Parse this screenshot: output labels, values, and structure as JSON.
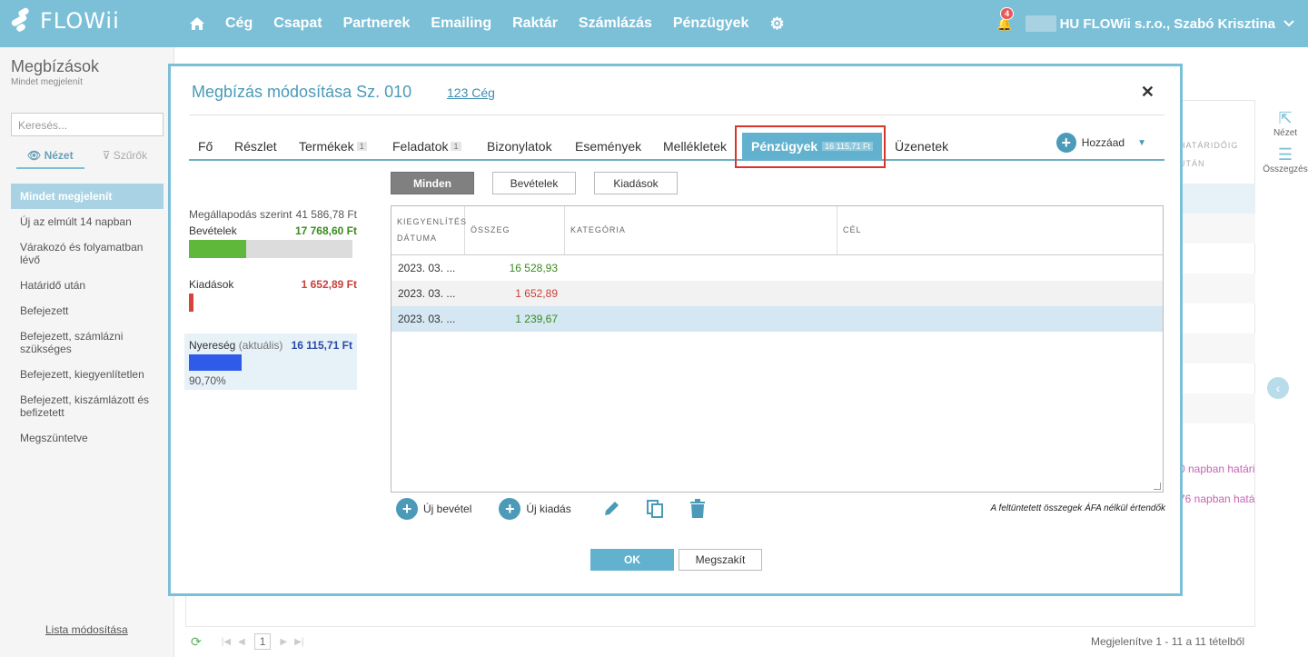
{
  "app": {
    "logo": "FLOWii"
  },
  "nav": {
    "items": [
      "Cég",
      "Csapat",
      "Partnerek",
      "Emailing",
      "Raktár",
      "Számlázás",
      "Pénzügyek"
    ]
  },
  "user": {
    "notifications": "4",
    "name": "HU FLOWii s.r.o., Szabó Krisztina"
  },
  "sidebar": {
    "title": "Megbízások",
    "subtitle": "Mindet megjelenít",
    "search_placeholder": "Keresés...",
    "tab_view": "Nézet",
    "tab_filters": "Szűrők",
    "items": [
      "Mindet megjelenít",
      "Új az elmúlt 14 napban",
      "Várakozó és folyamatban lévő",
      "Határidő után",
      "Befejezett",
      "Befejezett, számlázni szükséges",
      "Befejezett, kiegyenlítetlen",
      "Befejezett, kiszámlázott és befizetett",
      "Megszüntetve"
    ],
    "footer": "Lista módosítása"
  },
  "background": {
    "col_header_1": "HATÁRIDŐIG",
    "col_header_2": "UTÁN",
    "row_text_1": "0 napban határi",
    "row_text_2": "76 napban hatá",
    "rail_view": "Nézet",
    "rail_summary": "Összegzés",
    "pager_current": "1",
    "pager_info": "Megjelenítve 1 - 11 a 11 tételből"
  },
  "modal": {
    "title": "Megbízás módosítása Sz. 010",
    "company_link": "123 Cég",
    "tabs": [
      {
        "label": "Fő",
        "count": ""
      },
      {
        "label": "Részlet",
        "count": ""
      },
      {
        "label": "Termékek",
        "count": "1"
      },
      {
        "label": "Feladatok",
        "count": "1"
      },
      {
        "label": "Bizonylatok",
        "count": ""
      },
      {
        "label": "Események",
        "count": ""
      },
      {
        "label": "Mellékletek",
        "count": ""
      },
      {
        "label": "Pénzügyek",
        "count": "16 115,71 Ft"
      },
      {
        "label": "Üzenetek",
        "count": ""
      }
    ],
    "add_label": "Hozzáad",
    "filters": {
      "all": "Minden",
      "income": "Bevételek",
      "expense": "Kiadások"
    },
    "summary": {
      "agreement_label": "Megállapodás szerint",
      "agreement_value": "41 586,78 Ft",
      "income_label": "Bevételek",
      "income_value": "17 768,60 Ft",
      "income_fill": 0.35,
      "expense_label": "Kiadások",
      "expense_value": "1 652,89 Ft",
      "profit_label": "Nyereség",
      "profit_paren": "(aktuális)",
      "profit_value": "16 115,71 Ft",
      "profit_pct": "90,70%"
    },
    "table": {
      "headers": {
        "date_1": "KIEGYENLÍTÉS",
        "date_2": "DÁTUMA",
        "amount": "ÖSSZEG",
        "category": "KATEGÓRIA",
        "goal": "CÉL"
      },
      "rows": [
        {
          "date": "2023. 03. ...",
          "amount": "16 528,93",
          "color": "#3a8a1e"
        },
        {
          "date": "2023. 03. ...",
          "amount": "1 652,89",
          "color": "#c9413a"
        },
        {
          "date": "2023. 03. ...",
          "amount": "1 239,67",
          "color": "#3a8a1e"
        }
      ]
    },
    "tools": {
      "new_income": "Új bevétel",
      "new_expense": "Új kiadás",
      "note": "A feltüntetett összegek ÁFA nélkül értendők"
    },
    "ok": "OK",
    "cancel": "Megszakít"
  }
}
